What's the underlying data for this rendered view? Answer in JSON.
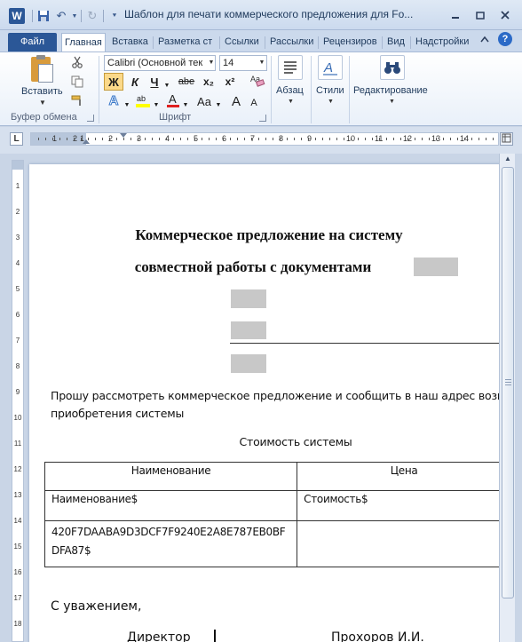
{
  "window": {
    "app_icon": "W",
    "title": "Шаблон для печати коммерческого предложения для Fo..."
  },
  "tabs": [
    {
      "label": "Файл"
    },
    {
      "label": "Главная"
    },
    {
      "label": "Вставка"
    },
    {
      "label": "Разметка ст"
    },
    {
      "label": "Ссылки"
    },
    {
      "label": "Рассылки"
    },
    {
      "label": "Рецензиров"
    },
    {
      "label": "Вид"
    },
    {
      "label": "Надстройки"
    }
  ],
  "ribbon": {
    "clipboard": {
      "paste_label": "Вставить",
      "group_label": "Буфер обмена"
    },
    "font": {
      "font_name": "Calibri (Основной тек",
      "font_size": "14",
      "bold": "Ж",
      "italic": "К",
      "underline": "Ч",
      "strike": "abe",
      "subscript": "x₂",
      "superscript": "x²",
      "change_case": "Aa",
      "grow": "A",
      "shrink": "A",
      "group_label": "Шрифт"
    },
    "paragraph": {
      "label": "Абзац"
    },
    "styles": {
      "label": "Стили"
    },
    "editing": {
      "label": "Редактирование"
    }
  },
  "ruler": {
    "corner": "L",
    "numbers": [
      "1",
      "2",
      "1",
      "2",
      "3",
      "4",
      "5",
      "6",
      "7",
      "8",
      "9",
      "10",
      "11",
      "12",
      "13",
      "14"
    ],
    "v_numbers": [
      "1",
      "2",
      "3",
      "4",
      "5",
      "6",
      "7",
      "8",
      "9",
      "10",
      "11",
      "12",
      "13",
      "14",
      "15",
      "16",
      "17",
      "18"
    ]
  },
  "document": {
    "title_line1": "Коммерческое предложение на систему",
    "title_line2": "совместной работы с документами",
    "paragraph_line1": "Прошу рассмотреть коммерческое предложение и сообщить в наш адрес возм",
    "paragraph_line2": "приобретения системы",
    "cost_heading": "Стоимость системы",
    "table": {
      "headers": [
        "Наименование",
        "Цена"
      ],
      "rows": [
        [
          "Наименование$",
          "Стоимость$"
        ],
        [
          "420F7DAABA9D3DCF7F9240E2A8E787EB0BF\nDFA87$",
          ""
        ]
      ]
    },
    "signature": "С уважением,",
    "sign_left": "Директор",
    "sign_right": "Прохоров И.И."
  }
}
